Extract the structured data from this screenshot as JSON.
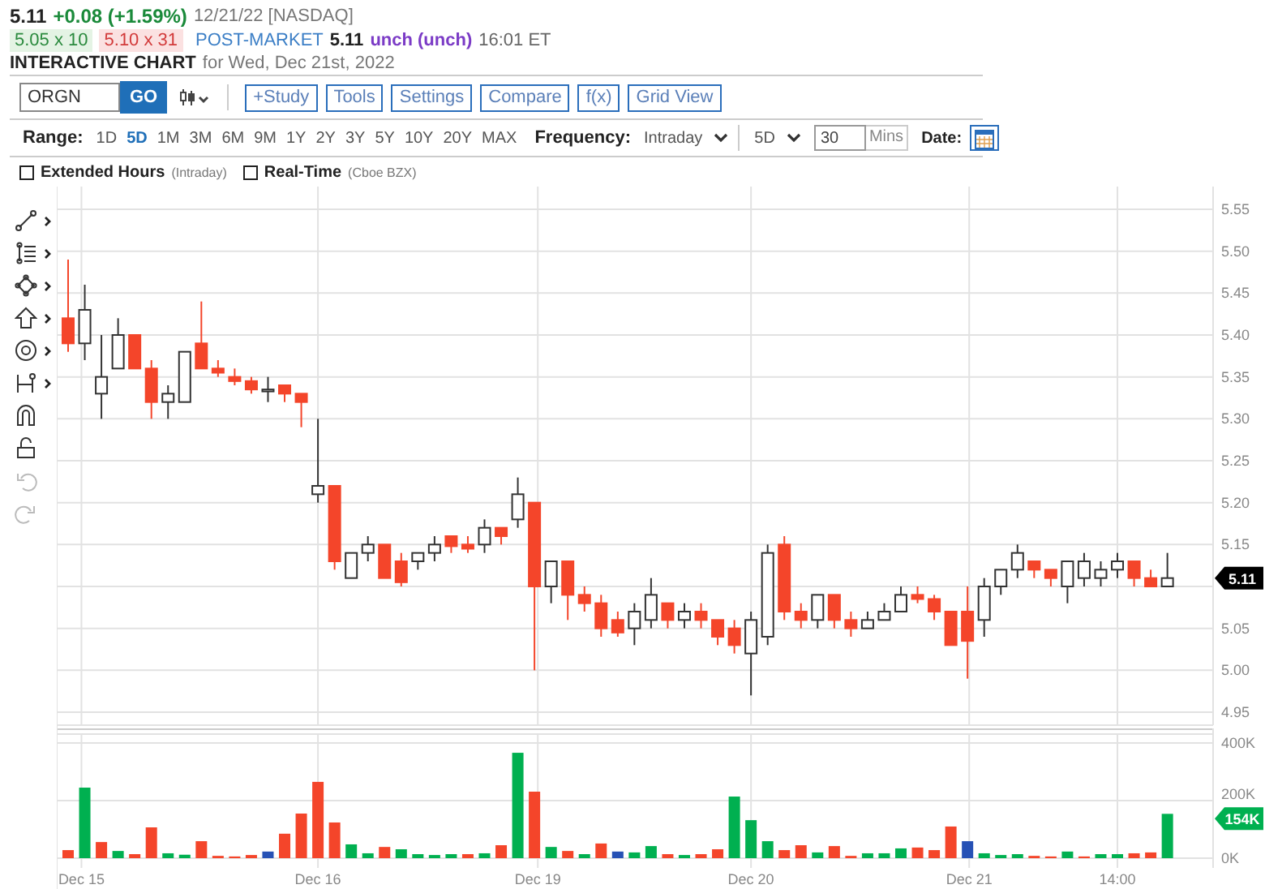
{
  "quote": {
    "price": "5.11",
    "change": "+0.08 (+1.59%)",
    "date": "12/21/22 [NASDAQ]"
  },
  "post_market": {
    "bid": "5.05 x 10",
    "ask": "5.10 x 31",
    "session": "POST-MARKET",
    "price": "5.11",
    "change": "unch (unch)",
    "time": "16:01 ET"
  },
  "heading": {
    "title": "INTERACTIVE CHART",
    "subtitle": "for Wed, Dec 21st, 2022"
  },
  "toolbar": {
    "symbol": "ORGN",
    "go": "GO",
    "buttons": [
      "+Study",
      "Tools",
      "Settings",
      "Compare",
      "f(x)",
      "Grid View"
    ]
  },
  "range_bar": {
    "label": "Range:",
    "ranges": [
      {
        "label": "1D",
        "selected": false
      },
      {
        "label": "5D",
        "selected": true
      },
      {
        "label": "1M",
        "selected": false
      },
      {
        "label": "3M",
        "selected": false
      },
      {
        "label": "6M",
        "selected": false
      },
      {
        "label": "9M",
        "selected": false
      },
      {
        "label": "1Y",
        "selected": false
      },
      {
        "label": "2Y",
        "selected": false
      },
      {
        "label": "3Y",
        "selected": false
      },
      {
        "label": "5Y",
        "selected": false
      },
      {
        "label": "10Y",
        "selected": false
      },
      {
        "label": "20Y",
        "selected": false
      },
      {
        "label": "MAX",
        "selected": false
      }
    ],
    "frequency_label": "Frequency:",
    "frequency": "Intraday",
    "period": "5D",
    "interval": "30",
    "interval_unit": "Mins",
    "date_label": "Date:"
  },
  "options": [
    {
      "label": "Extended Hours",
      "note": "(Intraday)",
      "checked": false
    },
    {
      "label": "Real-Time",
      "note": "(Cboe BZX)",
      "checked": false
    }
  ],
  "drawing_tools": [
    {
      "kind": "line",
      "submenu": true,
      "disabled": false
    },
    {
      "kind": "fib",
      "submenu": true,
      "disabled": false
    },
    {
      "kind": "shape",
      "submenu": true,
      "disabled": false
    },
    {
      "kind": "arrow",
      "submenu": true,
      "disabled": false
    },
    {
      "kind": "circle",
      "submenu": true,
      "disabled": false
    },
    {
      "kind": "measure",
      "submenu": true,
      "disabled": false
    },
    {
      "kind": "magnet",
      "submenu": false,
      "disabled": false
    },
    {
      "kind": "lock",
      "submenu": false,
      "disabled": false
    },
    {
      "kind": "undo",
      "submenu": false,
      "disabled": true
    },
    {
      "kind": "redo",
      "submenu": false,
      "disabled": true
    }
  ],
  "price_chart": {
    "last_price_tag": "5.11",
    "chart_data": {
      "type": "candlestick",
      "grid": true,
      "ylim": [
        4.95,
        5.55
      ],
      "yticks": [
        {
          "value": 5.55,
          "label": "5.55"
        },
        {
          "value": 5.5,
          "label": "5.50"
        },
        {
          "value": 5.45,
          "label": "5.45"
        },
        {
          "value": 5.4,
          "label": "5.40"
        },
        {
          "value": 5.35,
          "label": "5.35"
        },
        {
          "value": 5.3,
          "label": "5.30"
        },
        {
          "value": 5.25,
          "label": "5.25"
        },
        {
          "value": 5.2,
          "label": "5.20"
        },
        {
          "value": 5.15,
          "label": "5.15"
        },
        {
          "value": 5.05,
          "label": "5.05"
        },
        {
          "value": 5.0,
          "label": "5.00"
        },
        {
          "value": 4.95,
          "label": "4.95"
        }
      ],
      "ohlc": [
        [
          5.42,
          5.49,
          5.38,
          5.39
        ],
        [
          5.39,
          5.46,
          5.37,
          5.43
        ],
        [
          5.33,
          5.4,
          5.3,
          5.35
        ],
        [
          5.36,
          5.42,
          5.36,
          5.4
        ],
        [
          5.4,
          5.4,
          5.36,
          5.36
        ],
        [
          5.36,
          5.37,
          5.3,
          5.32
        ],
        [
          5.32,
          5.34,
          5.3,
          5.33
        ],
        [
          5.32,
          5.38,
          5.32,
          5.38
        ],
        [
          5.39,
          5.44,
          5.36,
          5.36
        ],
        [
          5.36,
          5.37,
          5.35,
          5.355
        ],
        [
          5.35,
          5.36,
          5.34,
          5.345
        ],
        [
          5.345,
          5.35,
          5.33,
          5.335
        ],
        [
          5.335,
          5.35,
          5.32,
          5.335
        ],
        [
          5.34,
          5.34,
          5.32,
          5.33
        ],
        [
          5.33,
          5.33,
          5.29,
          5.32
        ],
        [
          5.21,
          5.3,
          5.2,
          5.22
        ],
        [
          5.22,
          5.22,
          5.12,
          5.13
        ],
        [
          5.11,
          5.14,
          5.11,
          5.14
        ],
        [
          5.14,
          5.16,
          5.13,
          5.15
        ],
        [
          5.15,
          5.15,
          5.11,
          5.11
        ],
        [
          5.13,
          5.14,
          5.1,
          5.105
        ],
        [
          5.13,
          5.14,
          5.12,
          5.14
        ],
        [
          5.14,
          5.16,
          5.13,
          5.15
        ],
        [
          5.16,
          5.16,
          5.14,
          5.148
        ],
        [
          5.15,
          5.16,
          5.14,
          5.145
        ],
        [
          5.15,
          5.18,
          5.14,
          5.17
        ],
        [
          5.17,
          5.17,
          5.15,
          5.16
        ],
        [
          5.18,
          5.23,
          5.17,
          5.21
        ],
        [
          5.2,
          5.2,
          5.0,
          5.1
        ],
        [
          5.1,
          5.13,
          5.08,
          5.13
        ],
        [
          5.13,
          5.13,
          5.06,
          5.09
        ],
        [
          5.09,
          5.1,
          5.07,
          5.08
        ],
        [
          5.08,
          5.09,
          5.04,
          5.05
        ],
        [
          5.06,
          5.07,
          5.04,
          5.045
        ],
        [
          5.05,
          5.08,
          5.03,
          5.07
        ],
        [
          5.06,
          5.11,
          5.05,
          5.09
        ],
        [
          5.08,
          5.08,
          5.05,
          5.06
        ],
        [
          5.06,
          5.08,
          5.05,
          5.07
        ],
        [
          5.07,
          5.08,
          5.05,
          5.06
        ],
        [
          5.06,
          5.06,
          5.03,
          5.04
        ],
        [
          5.05,
          5.06,
          5.02,
          5.03
        ],
        [
          5.02,
          5.07,
          4.97,
          5.06
        ],
        [
          5.04,
          5.15,
          5.03,
          5.14
        ],
        [
          5.15,
          5.16,
          5.06,
          5.07
        ],
        [
          5.07,
          5.08,
          5.05,
          5.06
        ],
        [
          5.06,
          5.09,
          5.05,
          5.09
        ],
        [
          5.09,
          5.09,
          5.05,
          5.06
        ],
        [
          5.06,
          5.07,
          5.04,
          5.05
        ],
        [
          5.05,
          5.07,
          5.05,
          5.06
        ],
        [
          5.06,
          5.08,
          5.06,
          5.07
        ],
        [
          5.07,
          5.1,
          5.07,
          5.09
        ],
        [
          5.09,
          5.1,
          5.08,
          5.085
        ],
        [
          5.085,
          5.09,
          5.06,
          5.07
        ],
        [
          5.07,
          5.07,
          5.03,
          5.03
        ],
        [
          5.07,
          5.1,
          4.99,
          5.035
        ],
        [
          5.06,
          5.11,
          5.04,
          5.1
        ],
        [
          5.1,
          5.12,
          5.09,
          5.12
        ],
        [
          5.12,
          5.15,
          5.11,
          5.14
        ],
        [
          5.13,
          5.13,
          5.11,
          5.12
        ],
        [
          5.12,
          5.12,
          5.1,
          5.11
        ],
        [
          5.1,
          5.13,
          5.08,
          5.13
        ],
        [
          5.11,
          5.14,
          5.1,
          5.13
        ],
        [
          5.11,
          5.13,
          5.1,
          5.12
        ],
        [
          5.12,
          5.14,
          5.11,
          5.13
        ],
        [
          5.13,
          5.13,
          5.1,
          5.11
        ],
        [
          5.11,
          5.12,
          5.1,
          5.1
        ],
        [
          5.1,
          5.14,
          5.1,
          5.11
        ]
      ]
    }
  },
  "volume_chart": {
    "last_volume_tag": "154K",
    "chart_data": {
      "type": "bar",
      "grid": true,
      "yticks": [
        {
          "value": 0,
          "label": "0K"
        },
        {
          "value": 200,
          "label": "200K"
        },
        {
          "value": 400,
          "label": "400K"
        }
      ],
      "ylim": [
        0,
        400
      ],
      "series": [
        {
          "color": "#00b050",
          "values": [
            null,
            245,
            null,
            25,
            null,
            null,
            17,
            12,
            null,
            null,
            null,
            null,
            null,
            null,
            null,
            null,
            null,
            48,
            17,
            null,
            31,
            14,
            11,
            14,
            null,
            17,
            null,
            366,
            null,
            39,
            null,
            14,
            null,
            null,
            20,
            42,
            null,
            11,
            null,
            null,
            214,
            132,
            59,
            null,
            null,
            20,
            null,
            null,
            17,
            17,
            34,
            null,
            null,
            null,
            null,
            17,
            11,
            14,
            null,
            null,
            23,
            null,
            14,
            14,
            null,
            null,
            154
          ]
        },
        {
          "color": "#f4452a",
          "values": [
            28,
            null,
            56,
            null,
            14,
            107,
            null,
            null,
            59,
            8,
            6,
            11,
            null,
            85,
            155,
            265,
            124,
            null,
            null,
            39,
            null,
            null,
            null,
            null,
            14,
            null,
            45,
            null,
            231,
            null,
            25,
            null,
            51,
            null,
            null,
            null,
            14,
            null,
            14,
            31,
            null,
            null,
            null,
            28,
            45,
            null,
            42,
            8,
            null,
            null,
            null,
            37,
            28,
            110,
            null,
            null,
            null,
            null,
            8,
            6,
            null,
            6,
            null,
            null,
            17,
            20,
            null
          ]
        },
        {
          "color": "#2651b5",
          "values": [
            null,
            null,
            null,
            null,
            null,
            null,
            null,
            null,
            null,
            null,
            null,
            null,
            23,
            null,
            null,
            null,
            null,
            null,
            null,
            null,
            null,
            null,
            null,
            null,
            null,
            null,
            null,
            null,
            null,
            null,
            null,
            null,
            null,
            23,
            null,
            null,
            null,
            null,
            null,
            null,
            null,
            null,
            null,
            null,
            null,
            null,
            null,
            null,
            null,
            null,
            null,
            null,
            null,
            null,
            59,
            null,
            null,
            null,
            null,
            null,
            null,
            null,
            null,
            null,
            null,
            null,
            null
          ]
        }
      ]
    }
  },
  "time_labels": [
    "Dec 15",
    "Dec 16",
    "Dec 19",
    "Dec 20",
    "Dec 21",
    "14:00"
  ]
}
